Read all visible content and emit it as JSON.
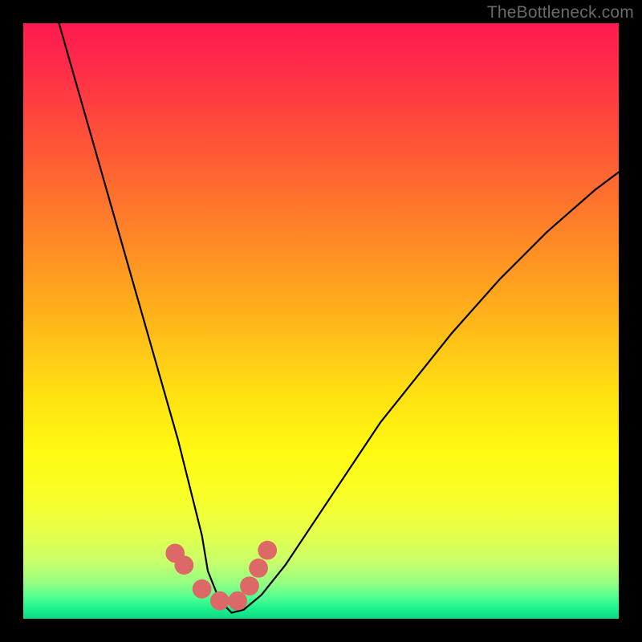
{
  "watermark": "TheBottleneck.com",
  "chart_data": {
    "type": "line",
    "title": "",
    "xlabel": "",
    "ylabel": "",
    "xlim": [
      0,
      100
    ],
    "ylim": [
      0,
      100
    ],
    "grid": false,
    "legend": false,
    "gradient_stops": [
      {
        "offset": 0,
        "color": "#ff1950"
      },
      {
        "offset": 0.08,
        "color": "#ff2e48"
      },
      {
        "offset": 0.22,
        "color": "#ff5a35"
      },
      {
        "offset": 0.36,
        "color": "#ff8726"
      },
      {
        "offset": 0.5,
        "color": "#ffb61a"
      },
      {
        "offset": 0.62,
        "color": "#ffe012"
      },
      {
        "offset": 0.72,
        "color": "#fffa12"
      },
      {
        "offset": 0.8,
        "color": "#f7ff2a"
      },
      {
        "offset": 0.86,
        "color": "#e4ff4d"
      },
      {
        "offset": 0.905,
        "color": "#c8ff6b"
      },
      {
        "offset": 0.94,
        "color": "#94ff82"
      },
      {
        "offset": 0.965,
        "color": "#4dff90"
      },
      {
        "offset": 0.985,
        "color": "#18ef8d"
      },
      {
        "offset": 1.0,
        "color": "#0fd885"
      }
    ],
    "series": [
      {
        "name": "bottleneck-curve",
        "x": [
          6,
          8,
          10,
          12,
          14,
          16,
          18,
          20,
          22,
          24,
          26,
          28,
          30,
          31,
          33,
          35,
          37,
          40,
          44,
          48,
          52,
          56,
          60,
          64,
          68,
          72,
          76,
          80,
          84,
          88,
          92,
          96,
          100
        ],
        "values": [
          100,
          93,
          86,
          79,
          72,
          65,
          58,
          51,
          44,
          37,
          30,
          22,
          14,
          8,
          3,
          1,
          1.5,
          4,
          9,
          15,
          21,
          27,
          33,
          38,
          43,
          48,
          52.5,
          57,
          61,
          65,
          68.5,
          72,
          75
        ]
      }
    ],
    "markers": {
      "name": "threshold-markers",
      "color": "#dd6868",
      "radius_pct": 1.6,
      "x": [
        25.5,
        27.0,
        30.0,
        33.0,
        36.0,
        38.0,
        39.5,
        41.0
      ],
      "values": [
        11.0,
        9.0,
        5.0,
        3.0,
        3.0,
        5.5,
        8.5,
        11.5
      ]
    }
  }
}
